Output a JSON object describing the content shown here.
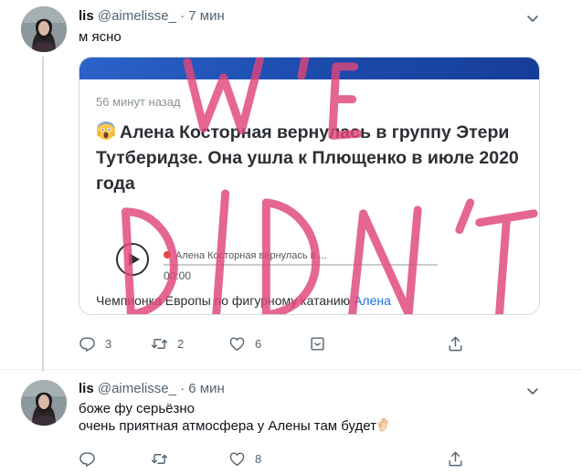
{
  "tweets": [
    {
      "name": "lis",
      "handle": "@aimelisse_",
      "separator": "·",
      "time": "7 мин",
      "text_lines": [
        "м ясно"
      ],
      "card": {
        "time_ago": "56 минут назад",
        "title": "Алена Косторная вернулась в группу Этери Тутберидзе. Она ушла к Плющенко в июле 2020 года",
        "audio_title": "Алена Косторная вернулась в ...",
        "audio_time": "00:00",
        "desc_text": "Чемпионка Европы по фигурному катанию ",
        "desc_link": "Алена"
      },
      "actions": {
        "reply": "3",
        "retweet": "2",
        "like": "6"
      }
    },
    {
      "name": "lis",
      "handle": "@aimelisse_",
      "separator": "·",
      "time": "6 мин",
      "text_lines": [
        "боже фу серьёзно",
        "очень приятная атмосфера у Алены там будет"
      ],
      "actions": {
        "reply": "",
        "retweet": "",
        "like": "8"
      }
    }
  ],
  "icons": [
    "reply-icon",
    "retweet-icon",
    "like-icon",
    "share-icon",
    "more-caret-icon",
    "ok-hand-icon",
    "screaming-face-icon"
  ],
  "colors": {
    "overlay_pink": "#e0457b",
    "card_blue": "#1d4cae",
    "link": "#1d6fd8"
  }
}
